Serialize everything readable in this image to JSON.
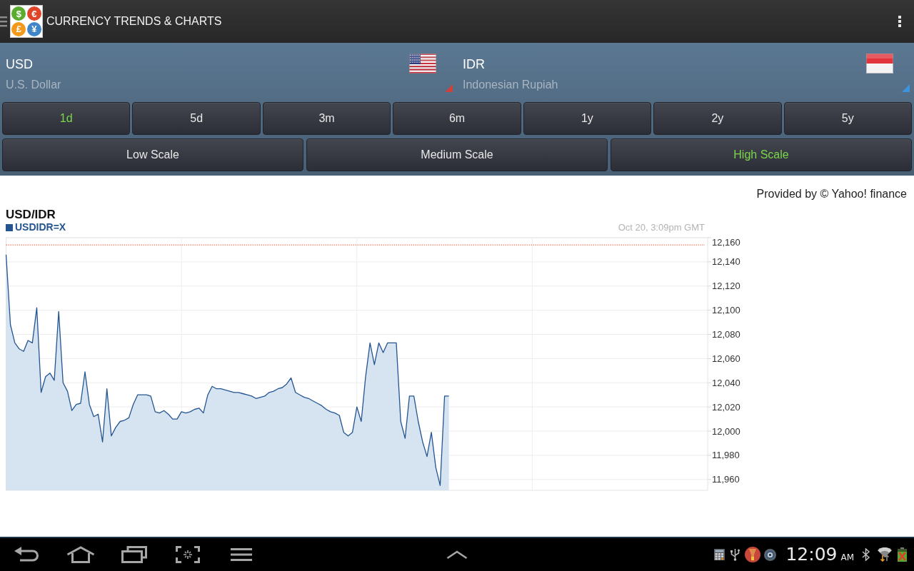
{
  "app_bar": {
    "logo": [
      {
        "symbol": "$",
        "color": "#5aab2e"
      },
      {
        "symbol": "€",
        "color": "#e0452a"
      },
      {
        "symbol": "£",
        "color": "#f39a1c"
      },
      {
        "symbol": "¥",
        "color": "#3f86c8"
      }
    ],
    "title": "CURRENCY TRENDS & CHARTS"
  },
  "currencies": [
    {
      "code": "USD",
      "name": "U.S. Dollar",
      "kind": "us",
      "color": "#c9443c"
    },
    {
      "code": "IDR",
      "name": "Indonesian Rupiah",
      "kind": "id",
      "color": "#3d93dc"
    }
  ],
  "periods": [
    {
      "label": "1d",
      "selected": true
    },
    {
      "label": "5d",
      "selected": false
    },
    {
      "label": "3m",
      "selected": false
    },
    {
      "label": "6m",
      "selected": false
    },
    {
      "label": "1y",
      "selected": false
    },
    {
      "label": "2y",
      "selected": false
    },
    {
      "label": "5y",
      "selected": false
    }
  ],
  "scales": [
    {
      "label": "Low Scale",
      "selected": false
    },
    {
      "label": "Medium Scale",
      "selected": false
    },
    {
      "label": "High Scale",
      "selected": true
    }
  ],
  "attribution": "Provided by © Yahoo! finance",
  "chart": {
    "timestamp": "Oct 20, 3:09pm GMT",
    "chart_data": {
      "type": "area",
      "title": "USD/IDR",
      "grid": true,
      "categories": [
        null,
        null,
        null,
        null,
        null,
        null,
        null,
        null,
        null,
        null,
        null,
        null,
        null,
        null,
        null,
        null,
        null,
        null,
        null,
        null,
        null,
        null,
        null,
        null,
        null,
        null,
        null,
        null,
        null,
        null,
        null,
        null,
        null,
        null,
        null,
        null,
        null,
        null,
        null,
        null,
        null,
        null,
        null,
        null,
        null,
        null,
        null,
        null,
        null,
        null,
        null,
        null,
        null,
        null,
        null,
        null,
        null,
        null,
        null,
        null,
        null,
        null,
        null,
        null,
        null,
        null,
        null,
        null,
        null,
        null,
        null,
        null,
        null,
        null,
        null,
        null,
        null,
        null,
        null,
        null,
        null,
        null,
        null,
        null,
        null,
        null,
        null,
        null,
        null,
        null,
        null,
        null,
        null,
        null,
        null,
        null,
        null,
        null,
        null,
        null,
        null,
        null,
        null,
        null,
        null,
        null,
        null,
        null,
        null,
        null,
        null,
        null,
        null,
        null,
        null,
        null,
        null,
        null,
        null,
        null,
        null,
        null,
        null,
        null,
        null,
        null,
        null,
        null,
        null,
        null,
        null,
        null,
        null,
        null,
        null,
        null,
        null,
        null,
        null,
        null,
        null,
        null,
        null,
        null,
        null,
        null,
        null,
        null,
        null,
        null,
        null,
        null,
        null,
        null,
        null,
        null,
        null,
        null,
        null,
        null
      ],
      "series": [
        {
          "name": "USDIDR=X",
          "color": "#245591",
          "values": [
            12146,
            12088,
            12073,
            12068,
            12066,
            12075,
            12073,
            12102,
            12032,
            12045,
            12048,
            12042,
            12099,
            12040,
            12033,
            12017,
            12022,
            12023,
            12049,
            12022,
            12012,
            12014,
            11991,
            12035,
            11996,
            12003,
            12008,
            12009,
            12011,
            12022,
            12030,
            12030,
            12030,
            12029,
            12016,
            12015,
            12017,
            12014,
            12010,
            12010,
            12016,
            12015,
            12016,
            12018,
            12019,
            12015,
            12030,
            12037,
            12035,
            12035,
            12034,
            12033,
            12032,
            12032,
            12031,
            12030,
            12029,
            12027,
            12028,
            12029,
            12032,
            12033,
            12035,
            12036,
            12039,
            12044,
            12032,
            12030,
            12028,
            12027,
            12025,
            12023,
            12021,
            12018,
            12016,
            12015,
            12013,
            11999,
            11996,
            11999,
            12020,
            12008,
            12045,
            12073,
            12055,
            12073,
            12065,
            12073,
            12073,
            12073,
            12008,
            11994,
            12029,
            12029,
            12008,
            11991,
            11979,
            11999,
            11970,
            11955,
            12029,
            12029,
            null,
            null,
            null,
            null,
            null,
            null,
            null,
            null,
            null,
            null,
            null,
            null,
            null,
            null,
            null,
            null,
            null,
            null,
            null,
            null,
            null,
            null,
            null,
            null,
            null,
            null,
            null,
            null,
            null,
            null,
            null,
            null,
            null,
            null,
            null,
            null,
            null,
            null,
            null,
            null,
            null,
            null,
            null,
            null,
            null,
            null,
            null,
            null,
            null,
            null,
            null,
            null,
            null,
            null,
            null,
            null,
            null,
            null
          ]
        }
      ],
      "ylim": [
        11951,
        12160
      ],
      "yticks": [
        {
          "value": 12160,
          "label": "12,160"
        },
        {
          "value": 12140,
          "label": "12,140"
        },
        {
          "value": 12120,
          "label": "12,120"
        },
        {
          "value": 12100,
          "label": "12,100"
        },
        {
          "value": 12080,
          "label": "12,080"
        },
        {
          "value": 12060,
          "label": "12,060"
        },
        {
          "value": 12040,
          "label": "12,040"
        },
        {
          "value": 12020,
          "label": "12,020"
        },
        {
          "value": 12000,
          "label": "12,000"
        },
        {
          "value": 11980,
          "label": "11,980"
        },
        {
          "value": 11960,
          "label": "11,960"
        }
      ],
      "ref_lines": [
        {
          "axis": "y",
          "value": 12154
        }
      ]
    }
  },
  "system_bar": {
    "time": "12:09",
    "period": "AM"
  }
}
